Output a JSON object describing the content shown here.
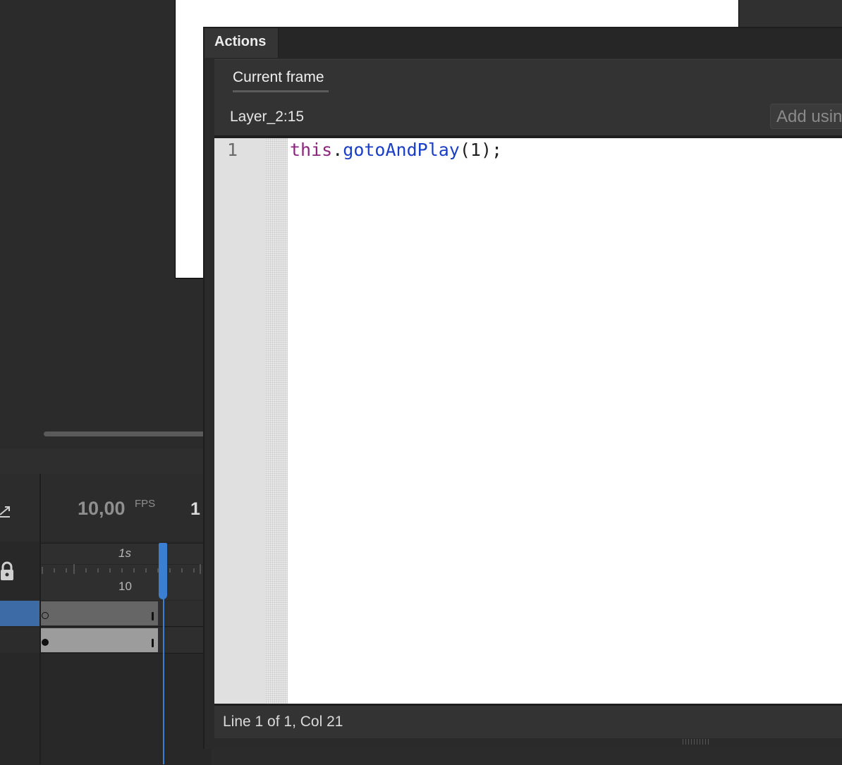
{
  "timeline": {
    "fps_value": "10,00",
    "fps_label": "FPS",
    "current_frame": "1",
    "ruler_time": "1s",
    "ruler_frame": "10"
  },
  "actions_panel": {
    "title": "Actions",
    "tab_label": "Current frame",
    "frame_location": "Layer_2:15",
    "add_button_label": "Add using wizard",
    "line_numbers": [
      "1"
    ],
    "code": {
      "keyword": "this",
      "dot": ".",
      "function": "gotoAndPlay",
      "args": "(1);"
    },
    "status": "Line 1 of 1, Col 21"
  },
  "colors": {
    "playhead": "#3a7fd1",
    "keyword": "#8d2580",
    "function": "#1a3fc6",
    "selected_layer": "#3c6ba6"
  },
  "icons": [
    "graph-icon",
    "lock-icon",
    "playhead-icon"
  ]
}
